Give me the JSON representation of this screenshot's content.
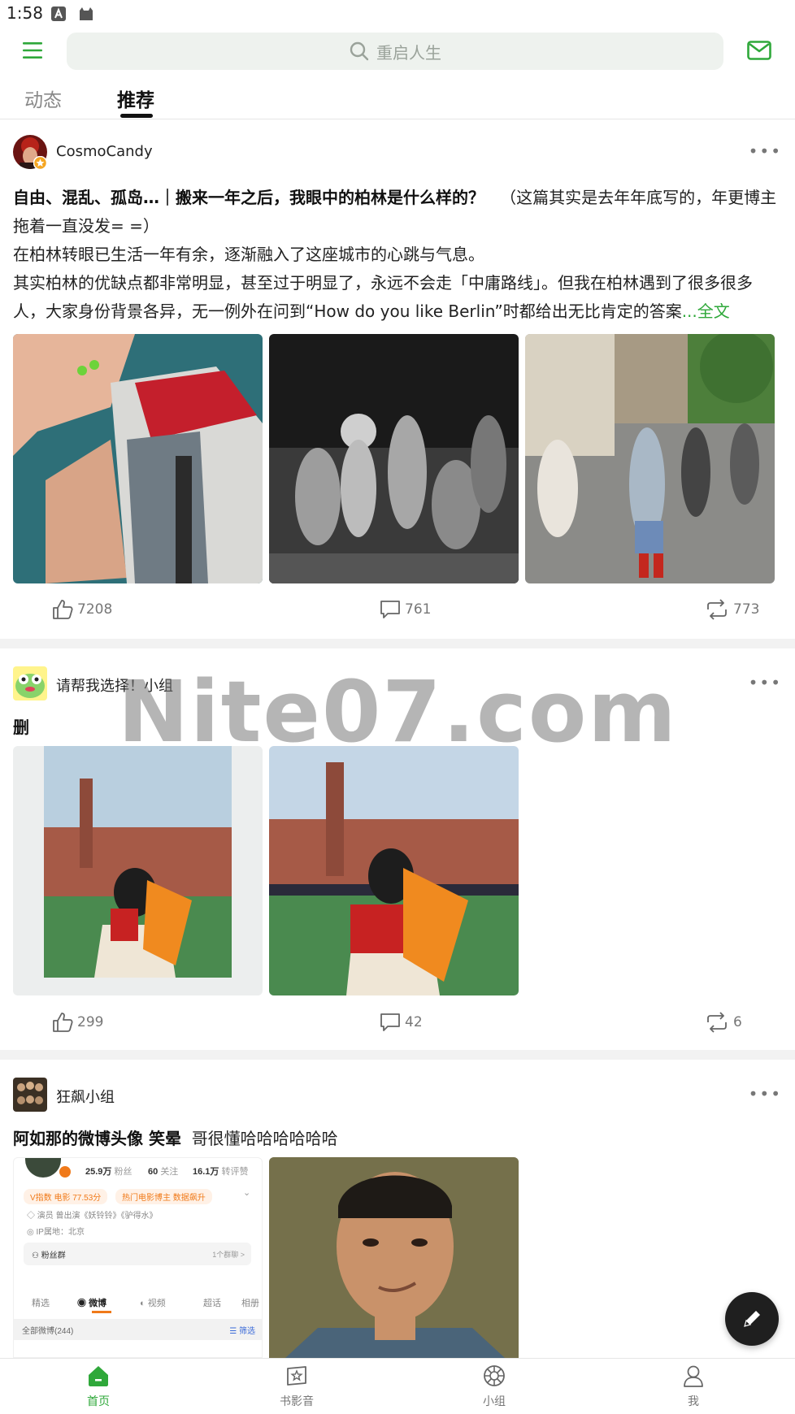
{
  "status_bar": {
    "time": "1:58"
  },
  "search": {
    "placeholder": "重启人生"
  },
  "tabs": [
    {
      "label": "动态"
    },
    {
      "label": "推荐"
    }
  ],
  "posts": [
    {
      "author": "CosmoCandy",
      "title": "自由、混乱、孤岛…｜搬来一年之后，我眼中的柏林是什么样的？",
      "body_part1": "（这篇其实是去年年底写的，年更博主拖着一直没发= =）",
      "body_part2": "在柏林转眼已生活一年有余，逐渐融入了这座城市的心跳与气息。",
      "body_part3": "其实柏林的优缺点都非常明显，甚至过于明显了，永远不会走「中庸路线」。但我在柏林遇到了很多很多人，大家身份背景各异，无一例外在问到“How do you like Berlin”时都给出无比肯定的答案",
      "more_link": "...全文",
      "likes": "7208",
      "comments": "761",
      "reposts": "773"
    },
    {
      "author": "请帮我选择！小组",
      "body": "删",
      "likes": "299",
      "comments": "42",
      "reposts": "6"
    },
    {
      "author": "狂飙小组",
      "title": "阿如那的微博头像 笑晕",
      "body": "哥很懂哈哈哈哈哈哈",
      "screenshot": {
        "followers": "25.9万",
        "followers_label": "粉丝",
        "following": "60",
        "following_label": "关注",
        "reposts_likes": "16.1万",
        "reposts_likes_label": "转评赞",
        "tag1": "V指数 电影 77.53分",
        "tag2": "热门电影博主 数据飙升",
        "actor": "演员 曾出演《妖铃铃》《驴得水》",
        "ip": "IP属地：北京",
        "fan_group": "粉丝群",
        "fan_group_count": "1个群聊 >",
        "tab_featured": "精选",
        "tab_weibo": "微博",
        "tab_video": "视频",
        "tab_chao": "超话",
        "tab_album": "相册",
        "all_weibo": "全部微博(244)",
        "filter": "筛选"
      }
    }
  ],
  "watermark": "Nite07.com",
  "bottom_nav": [
    {
      "label": "首页"
    },
    {
      "label": "书影音"
    },
    {
      "label": "小组"
    },
    {
      "label": "我"
    }
  ],
  "colors": {
    "accent": "#2fa83a",
    "text": "#222222",
    "muted": "#777777"
  }
}
